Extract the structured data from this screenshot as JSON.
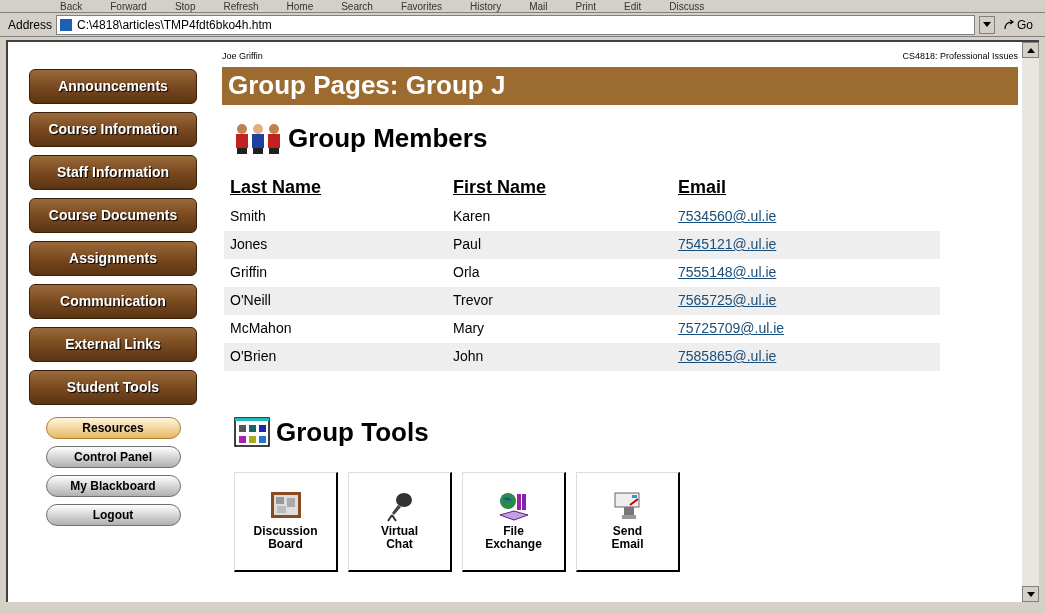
{
  "toolbar": [
    "Back",
    "Forward",
    "Stop",
    "Refresh",
    "Home",
    "Search",
    "Favorites",
    "History",
    "Mail",
    "Print",
    "Edit",
    "Discuss"
  ],
  "address_bar": {
    "label": "Address",
    "value": "C:\\4818\\articles\\TMP4fdt6bko4h.htm",
    "go": "Go"
  },
  "header": {
    "user": "Joe Griffin",
    "course": "CS4818: Professional Issues"
  },
  "sidebar": {
    "main_buttons": [
      "Announcements",
      "Course Information",
      "Staff Information",
      "Course Documents",
      "Assignments",
      "Communication",
      "External Links",
      "Student Tools"
    ],
    "sub_buttons": [
      {
        "label": "Resources",
        "selected": true
      },
      {
        "label": "Control Panel",
        "selected": false
      },
      {
        "label": "My Blackboard",
        "selected": false
      },
      {
        "label": "Logout",
        "selected": false
      }
    ]
  },
  "page_title": "Group Pages: Group J",
  "members": {
    "heading": "Group Members",
    "columns": [
      "Last Name",
      "First Name",
      "Email"
    ],
    "rows": [
      [
        "Smith",
        "Karen",
        "7534560@.ul.ie"
      ],
      [
        "Jones",
        "Paul",
        "7545121@.ul.ie"
      ],
      [
        "Griffin",
        "Orla",
        "7555148@.ul.ie"
      ],
      [
        "O'Neill",
        "Trevor",
        "7565725@.ul.ie"
      ],
      [
        "McMahon",
        "Mary",
        "75725709@.ul.ie"
      ],
      [
        "O'Brien",
        "John",
        "7585865@.ul.ie"
      ]
    ]
  },
  "tools": {
    "heading": "Group Tools",
    "items": [
      {
        "kind": "discussion",
        "label": [
          "Discussion",
          "Board"
        ]
      },
      {
        "kind": "chat",
        "label": [
          "Virtual",
          "Chat"
        ]
      },
      {
        "kind": "exchange",
        "label": [
          "File",
          "Exchange"
        ]
      },
      {
        "kind": "email",
        "label": [
          "Send",
          "Email"
        ]
      }
    ]
  }
}
